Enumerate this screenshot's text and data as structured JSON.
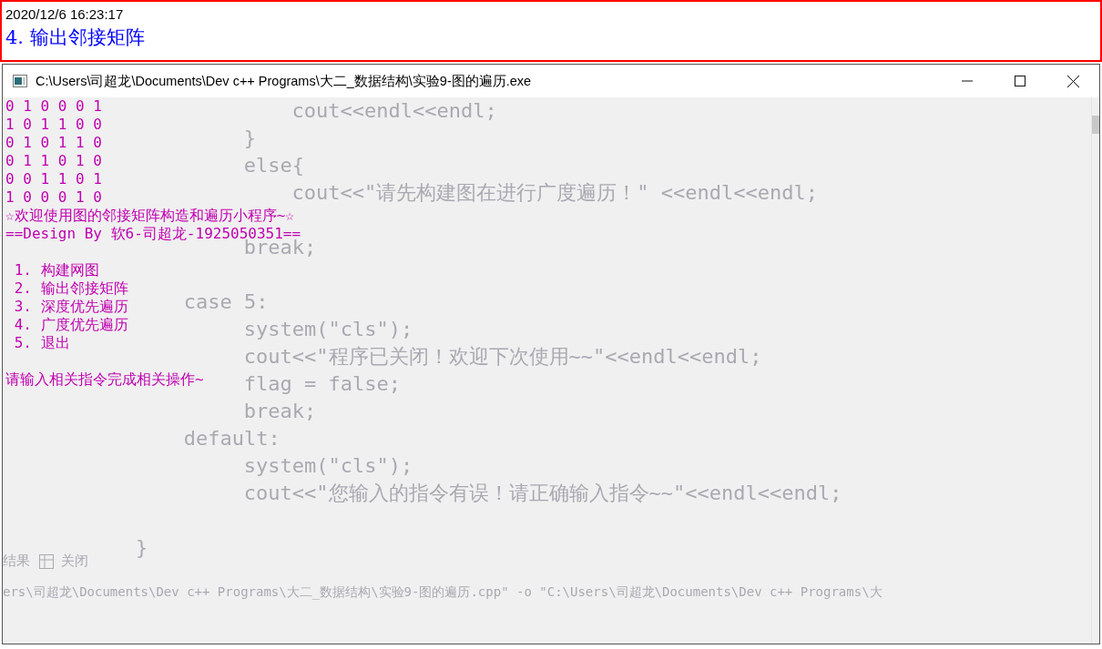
{
  "header": {
    "timestamp": "2020/12/6 16:23:17",
    "title": "4. 输出邻接矩阵"
  },
  "console_window": {
    "title": "C:\\Users\\司超龙\\Documents\\Dev c++ Programs\\大二_数据结构\\实验9-图的遍历.exe",
    "background_code_blocks": [
      [
        "             cout<<endl<<endl;",
        "         }",
        "         else{",
        "             cout<<\"请先构建图在进行广度遍历！\" <<endl<<endl;"
      ],
      [
        "         break;"
      ],
      [
        "    case 5:",
        "         system(\"cls\");",
        "         cout<<\"程序已关闭！欢迎下次使用~~\"<<endl<<endl;",
        "         flag = false;",
        "         break;",
        "    default:",
        "         system(\"cls\");",
        "         cout<<\"您输入的指令有误！请正确输入指令~~\"<<endl<<endl;"
      ],
      [
        "}"
      ]
    ],
    "background_tabs": [
      "结果",
      "关闭"
    ],
    "background_log": "ers\\司超龙\\Documents\\Dev c++ Programs\\大二_数据结构\\实验9-图的遍历.cpp\" -o \"C:\\Users\\司超龙\\Documents\\Dev c++ Programs\\大",
    "output_blocks": [
      [
        "0 1 0 0 0 1",
        "1 0 1 1 0 0",
        "0 1 0 1 1 0",
        "0 1 1 0 1 0",
        "0 0 1 1 0 1",
        "1 0 0 0 1 0",
        "☆欢迎使用图的邻接矩阵构造和遍历小程序~☆",
        "==Design By 软6-司超龙-1925050351=="
      ],
      [
        " 1. 构建网图",
        " 2. 输出邻接矩阵",
        " 3. 深度优先遍历",
        " 4. 广度优先遍历",
        " 5. 退出"
      ],
      [
        "请输入相关指令完成相关操作~"
      ]
    ]
  }
}
